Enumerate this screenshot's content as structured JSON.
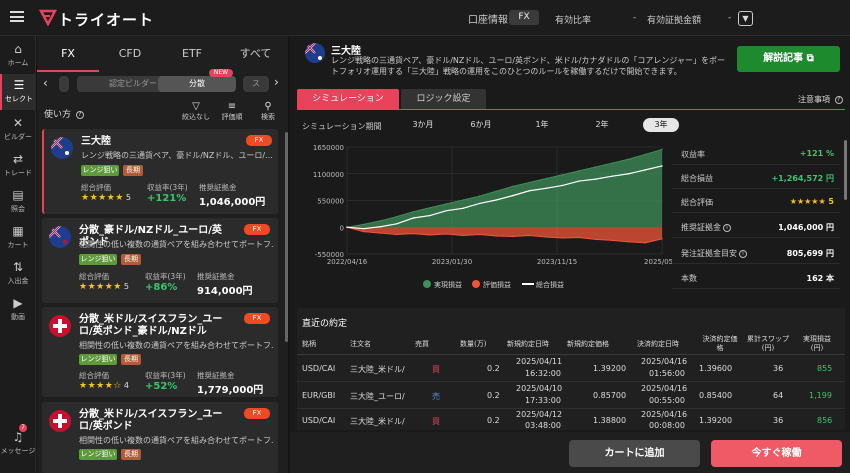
{
  "header": {
    "logo": "トライオート",
    "account_label": "口座情報",
    "account_type": "FX",
    "ratio_label": "有効比率",
    "ratio_value": "-",
    "margin_label": "有効証拠金額",
    "margin_value": "-"
  },
  "nav": [
    {
      "label": "ホーム",
      "icon": "home-icon"
    },
    {
      "label": "セレクト",
      "icon": "select-icon"
    },
    {
      "label": "ビルダー",
      "icon": "builder-icon"
    },
    {
      "label": "トレード",
      "icon": "trade-icon"
    },
    {
      "label": "照会",
      "icon": "inquiry-icon"
    },
    {
      "label": "カート",
      "icon": "cart-icon"
    },
    {
      "label": "入出金",
      "icon": "deposit-icon"
    },
    {
      "label": "動画",
      "icon": "video-icon"
    },
    {
      "label": "メッセージ",
      "icon": "message-icon",
      "badge": "7"
    }
  ],
  "market_tabs": [
    "FX",
    "CFD",
    "ETF",
    "すべて"
  ],
  "chips": [
    "認定ビルダー",
    "分散",
    "ス"
  ],
  "chip_new": "NEW",
  "howto": "使い方",
  "tools": [
    "絞込なし",
    "評価順",
    "検索"
  ],
  "labels": {
    "rating": "総合評価",
    "return": "収益率(3年)",
    "margin": "推奨証拠金"
  },
  "cards": [
    {
      "title": "三大陸",
      "desc": "レンジ戦略の三通貨ペア、豪ドル/NZドル、ユーロ/...",
      "badge": "FX",
      "tags": [
        "レンジ狙い",
        "長期"
      ],
      "stars": "★★★★★",
      "score": "5",
      "ret": "+121%",
      "margin": "1,046,000円"
    },
    {
      "title": "分散_豪ドル/NZドル_ユーロ/英ポンド",
      "desc": "相関性の低い複数の通貨ペアを組み合わせてポートフ...",
      "badge": "FX",
      "tags": [
        "レンジ狙い",
        "長期"
      ],
      "stars": "★★★★★",
      "score": "5",
      "ret": "+86%",
      "margin": "914,000円"
    },
    {
      "title": "分散_米ドル/スイスフラン_ユーロ/英ポンド_豪ドル/NZドル",
      "desc": "相関性の低い複数の通貨ペアを組み合わせてポートフ...",
      "badge": "FX",
      "tags": [
        "レンジ狙い",
        "長期"
      ],
      "stars": "★★★★☆",
      "score": "4",
      "ret": "+52%",
      "margin": "1,779,000円"
    },
    {
      "title": "分散_米ドル/スイスフラン_ユーロ/英ポンド",
      "desc": "相関性の低い複数の通貨ペアを組み合わせてポートフ...",
      "badge": "FX",
      "tags": [
        "レンジ狙い",
        "長期"
      ],
      "stars": "",
      "score": "",
      "ret": "",
      "margin": ""
    }
  ],
  "strategy": {
    "title": "三大陸",
    "desc": "レンジ戦略の三通貨ペア、豪ドル/NZドル、ユーロ/英ポンド、米ドル/カナダドルの「コアレンジャー」をポートフォリオ運用する「三大陸」戦略の運用をこのひとつのルールを稼働するだけで開始できます。",
    "explain_button": "解説記事",
    "tab_sim": "シミュレーション",
    "tab_logic": "ロジック設定",
    "notes": "注意事項"
  },
  "period": {
    "label": "シミュレーション期間",
    "options": [
      "3か月",
      "6か月",
      "1年",
      "2年",
      "3年"
    ],
    "selected": "3年"
  },
  "chart_data": {
    "type": "area",
    "x": [
      "2022/04/16",
      "2023/01/30",
      "2023/11/15",
      "2025/05/1"
    ],
    "y_ticks": [
      "1650000",
      "1100000",
      "550000",
      "0",
      "-550000"
    ],
    "ylim": [
      -550000,
      1650000
    ],
    "series": [
      {
        "name": "実現損益",
        "color": "#3e8f5a",
        "values": [
          0,
          60000,
          130000,
          220000,
          320000,
          400000,
          480000,
          560000,
          640000,
          740000,
          840000,
          920000,
          1000000,
          1080000,
          1160000,
          1240000,
          1320000,
          1400000,
          1500000,
          1600000
        ]
      },
      {
        "name": "評価損益",
        "color": "#f0553a",
        "values": [
          0,
          -90000,
          -120000,
          -150000,
          -130000,
          -160000,
          -140000,
          -170000,
          -150000,
          -180000,
          -190000,
          -170000,
          -200000,
          -220000,
          -210000,
          -250000,
          -270000,
          -300000,
          -320000,
          -240000
        ]
      },
      {
        "name": "総合損益",
        "color": "#ffffff",
        "values": [
          0,
          -30000,
          10000,
          70000,
          190000,
          240000,
          340000,
          390000,
          490000,
          560000,
          650000,
          750000,
          800000,
          860000,
          950000,
          990000,
          1050000,
          1100000,
          1180000,
          1260000
        ]
      }
    ]
  },
  "stats": [
    {
      "label": "収益率",
      "value": "+121 %",
      "cls": "g"
    },
    {
      "label": "総合損益",
      "value": "+1,264,572 円",
      "cls": "g"
    },
    {
      "label": "総合評価",
      "value": "★★★★★ 5",
      "cls": "st"
    },
    {
      "label": "推奨証拠金",
      "value": "1,046,000 円",
      "cls": "",
      "info": "i"
    },
    {
      "label": "発注証拠金目安",
      "value": "805,699 円",
      "cls": "",
      "info": "i"
    },
    {
      "label": "本数",
      "value": "162 本",
      "cls": ""
    }
  ],
  "recent": {
    "title": "直近の約定",
    "headers": [
      "銘柄",
      "注文名",
      "売買",
      "数量(万)",
      "新規約定日時",
      "新規約定価格",
      "決済約定日時",
      "決済約定価格",
      "累計スワップ(円)",
      "実現損益(円)"
    ],
    "rows": [
      {
        "pair": "USD/CAI",
        "name": "三大陸_米ドル/",
        "side": "買",
        "side_cls": "r",
        "qty": "0.2",
        "open_d": "2025/04/11",
        "open_t": "16:32:00",
        "open_p": "1.39200",
        "close_d": "2025/04/16",
        "close_t": "01:56:00",
        "close_p": "1.39600",
        "swap": "36",
        "pl": "855"
      },
      {
        "pair": "EUR/GBI",
        "name": "三大陸_ユーロ/",
        "side": "売",
        "side_cls": "b",
        "qty": "0.2",
        "open_d": "2025/04/10",
        "open_t": "17:33:00",
        "open_p": "0.85700",
        "close_d": "2025/04/16",
        "close_t": "00:55:00",
        "close_p": "0.85400",
        "swap": "64",
        "pl": "1,199"
      },
      {
        "pair": "USD/CAI",
        "name": "三大陸_米ドル/",
        "side": "買",
        "side_cls": "r",
        "qty": "0.2",
        "open_d": "2025/04/12",
        "open_t": "03:48:00",
        "open_p": "1.38800",
        "close_d": "2025/04/16",
        "close_t": "00:08:00",
        "close_p": "1.39200",
        "swap": "36",
        "pl": "856"
      }
    ]
  },
  "buttons": {
    "cart": "カートに追加",
    "run": "今すぐ稼働"
  }
}
